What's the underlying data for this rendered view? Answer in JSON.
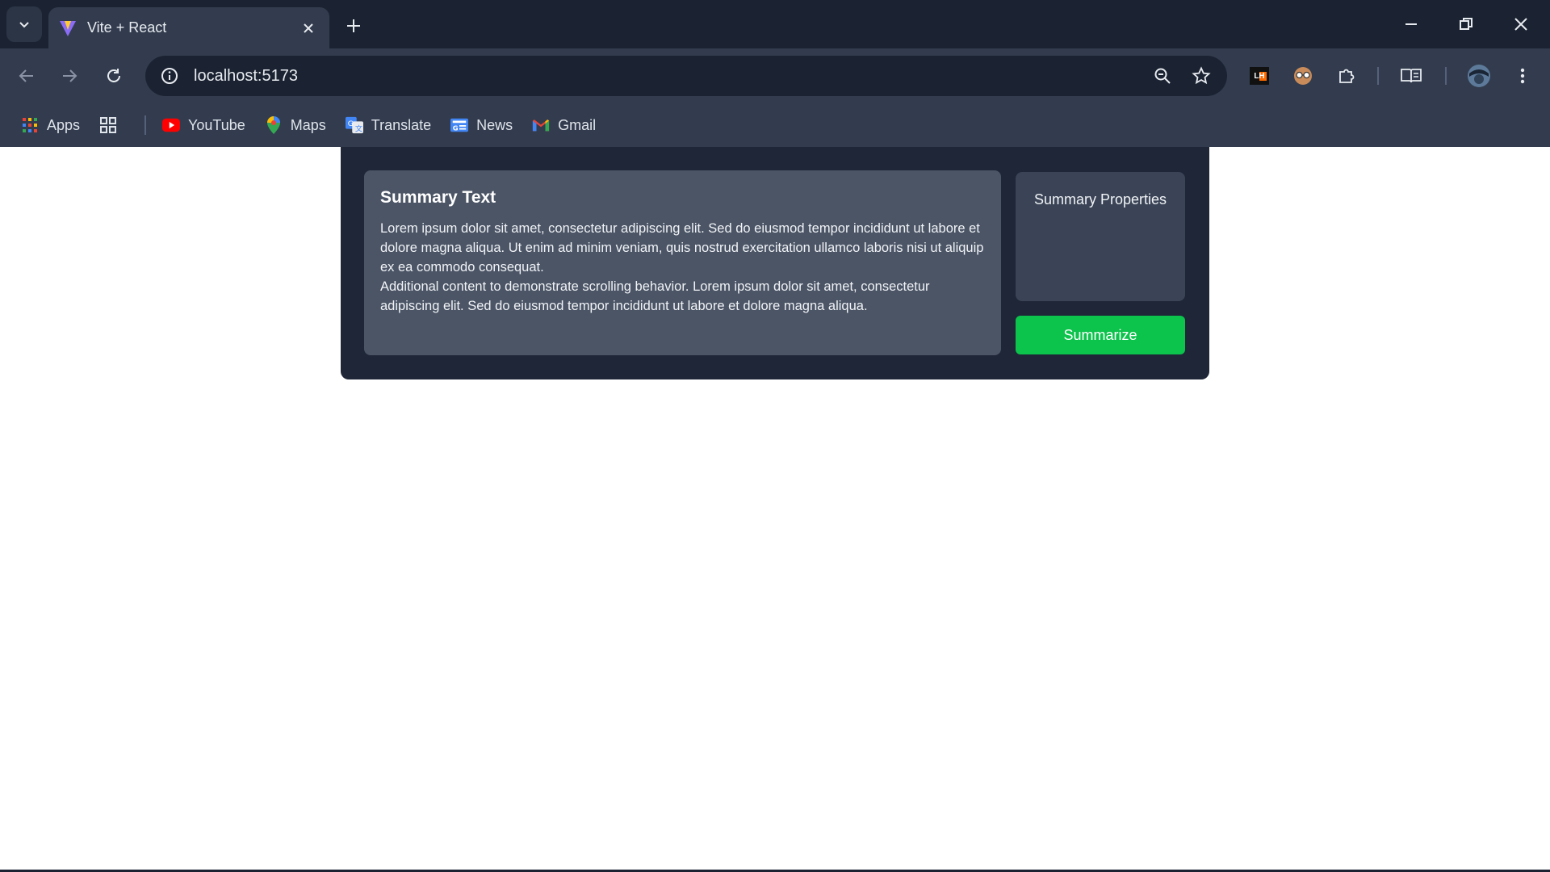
{
  "browser": {
    "tab_title": "Vite + React",
    "url": "localhost:5173",
    "bookmarks": [
      {
        "label": "Apps"
      },
      {
        "label": "YouTube"
      },
      {
        "label": "Maps"
      },
      {
        "label": "Translate"
      },
      {
        "label": "News"
      },
      {
        "label": "Gmail"
      }
    ],
    "extension_lighthouse_label": "LH"
  },
  "app": {
    "summary_title": "Summary Text",
    "summary_paragraph_1": "Lorem ipsum dolor sit amet, consectetur adipiscing elit. Sed do eiusmod tempor incididunt ut labore et dolore magna aliqua. Ut enim ad minim veniam, quis nostrud exercitation ullamco laboris nisi ut aliquip ex ea commodo consequat.",
    "summary_paragraph_2": "Additional content to demonstrate scrolling behavior. Lorem ipsum dolor sit amet, consectetur adipiscing elit. Sed do eiusmod tempor incididunt ut labore et dolore magna aliqua.",
    "properties_title": "Summary Properties",
    "summarize_label": "Summarize"
  },
  "colors": {
    "chrome_dark": "#1b2332",
    "chrome_mid": "#323c4e",
    "card_bg": "#1e2637",
    "text_panel_bg": "#4b5566",
    "props_panel_bg": "#3a4456",
    "accent_green": "#0cc34c"
  }
}
